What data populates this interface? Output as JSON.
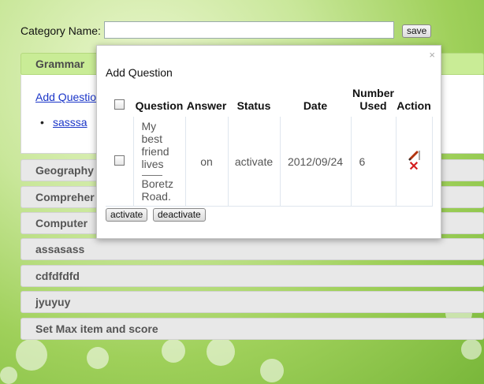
{
  "category": {
    "label": "Category Name:",
    "value": "",
    "save_label": "save"
  },
  "accordion": [
    {
      "label": "Grammar",
      "active": true
    },
    {
      "label": "Geography"
    },
    {
      "label": "Compreher"
    },
    {
      "label": "Computer"
    },
    {
      "label": "assasass"
    },
    {
      "label": "cdfdfdfd"
    },
    {
      "label": "jyuyuy"
    },
    {
      "label": "Set Max item and score"
    }
  ],
  "grammar_panel": {
    "add_link": "Add Questio",
    "item": "sasssa"
  },
  "modal": {
    "title": "Add Question",
    "close_icon": "×",
    "columns": [
      "Question",
      "Answer",
      "Status",
      "Date",
      "Number Used",
      "Action"
    ],
    "rows": [
      {
        "question_line1": "My best friend lives",
        "question_line2": "Boretz Road.",
        "answer": "on",
        "status": "activate",
        "date": "2012/09/24",
        "number_used": "6"
      }
    ],
    "buttons": {
      "activate": "activate",
      "deactivate": "deactivate"
    }
  },
  "colors": {
    "active_header": "#c9ec96",
    "link": "#1a35c8",
    "delete": "#d41e1e"
  }
}
